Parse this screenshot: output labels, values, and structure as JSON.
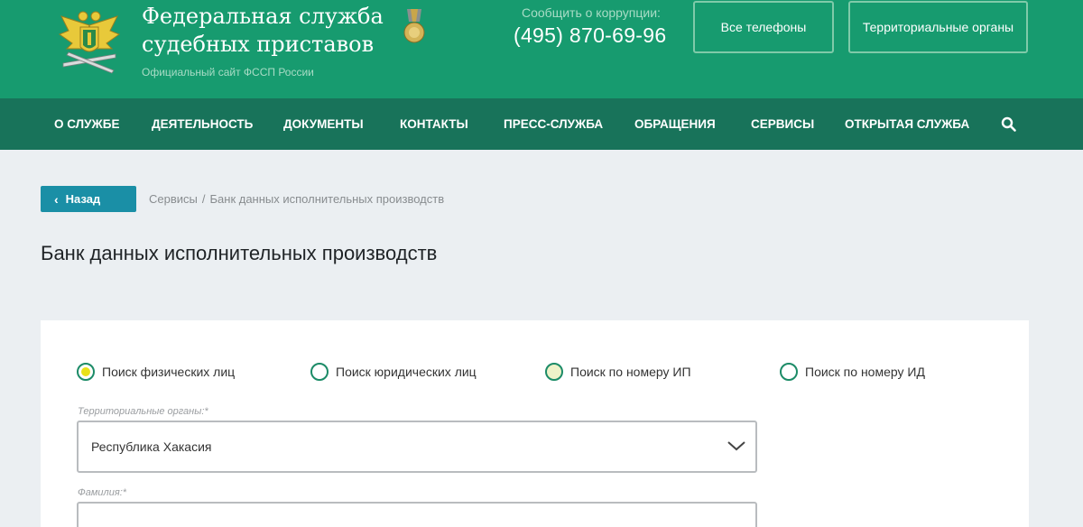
{
  "header": {
    "title": "Федеральная служба судебных приставов",
    "subtitle": "Официальный сайт ФССП России",
    "corruption_label": "Сообщить о коррупции:",
    "corruption_phone": "(495) 870-69-96",
    "buttons": {
      "phones": "Все телефоны",
      "regions": "Территориальные органы"
    }
  },
  "nav": {
    "items": [
      "О СЛУЖБЕ",
      "ДЕЯТЕЛЬНОСТЬ",
      "ДОКУМЕНТЫ",
      "КОНТАКТЫ",
      "ПРЕСС-СЛУЖБА",
      "ОБРАЩЕНИЯ",
      "СЕРВИСЫ",
      "ОТКРЫТАЯ СЛУЖБА"
    ],
    "search_icon": "search-icon"
  },
  "back_button": {
    "label": "Назад",
    "icon": "chevron-left-icon"
  },
  "breadcrumb": {
    "items": [
      "Сервисы",
      "Банк данных исполнительных производств"
    ],
    "separator": "/"
  },
  "page_title": "Банк данных исполнительных производств",
  "search_form": {
    "search_types": [
      {
        "label": "Поиск физических лиц",
        "selected": true
      },
      {
        "label": "Поиск юридических лиц",
        "selected": false
      },
      {
        "label": "Поиск по номеру ИП",
        "selected": false
      },
      {
        "label": "Поиск по номеру ИД",
        "selected": false
      }
    ],
    "region": {
      "label": "Территориальные органы:*",
      "value": "Республика Хакасия"
    },
    "lastname": {
      "label": "Фамилия:*",
      "value": ""
    }
  },
  "colors": {
    "header_bg": "#179b6f",
    "nav_bg": "#18735a",
    "back_button_bg": "#1a8fa6",
    "radio_ring": "#1c8b67",
    "radio_selected_dot": "#e9e11a",
    "page_bg": "#ebeff2"
  }
}
